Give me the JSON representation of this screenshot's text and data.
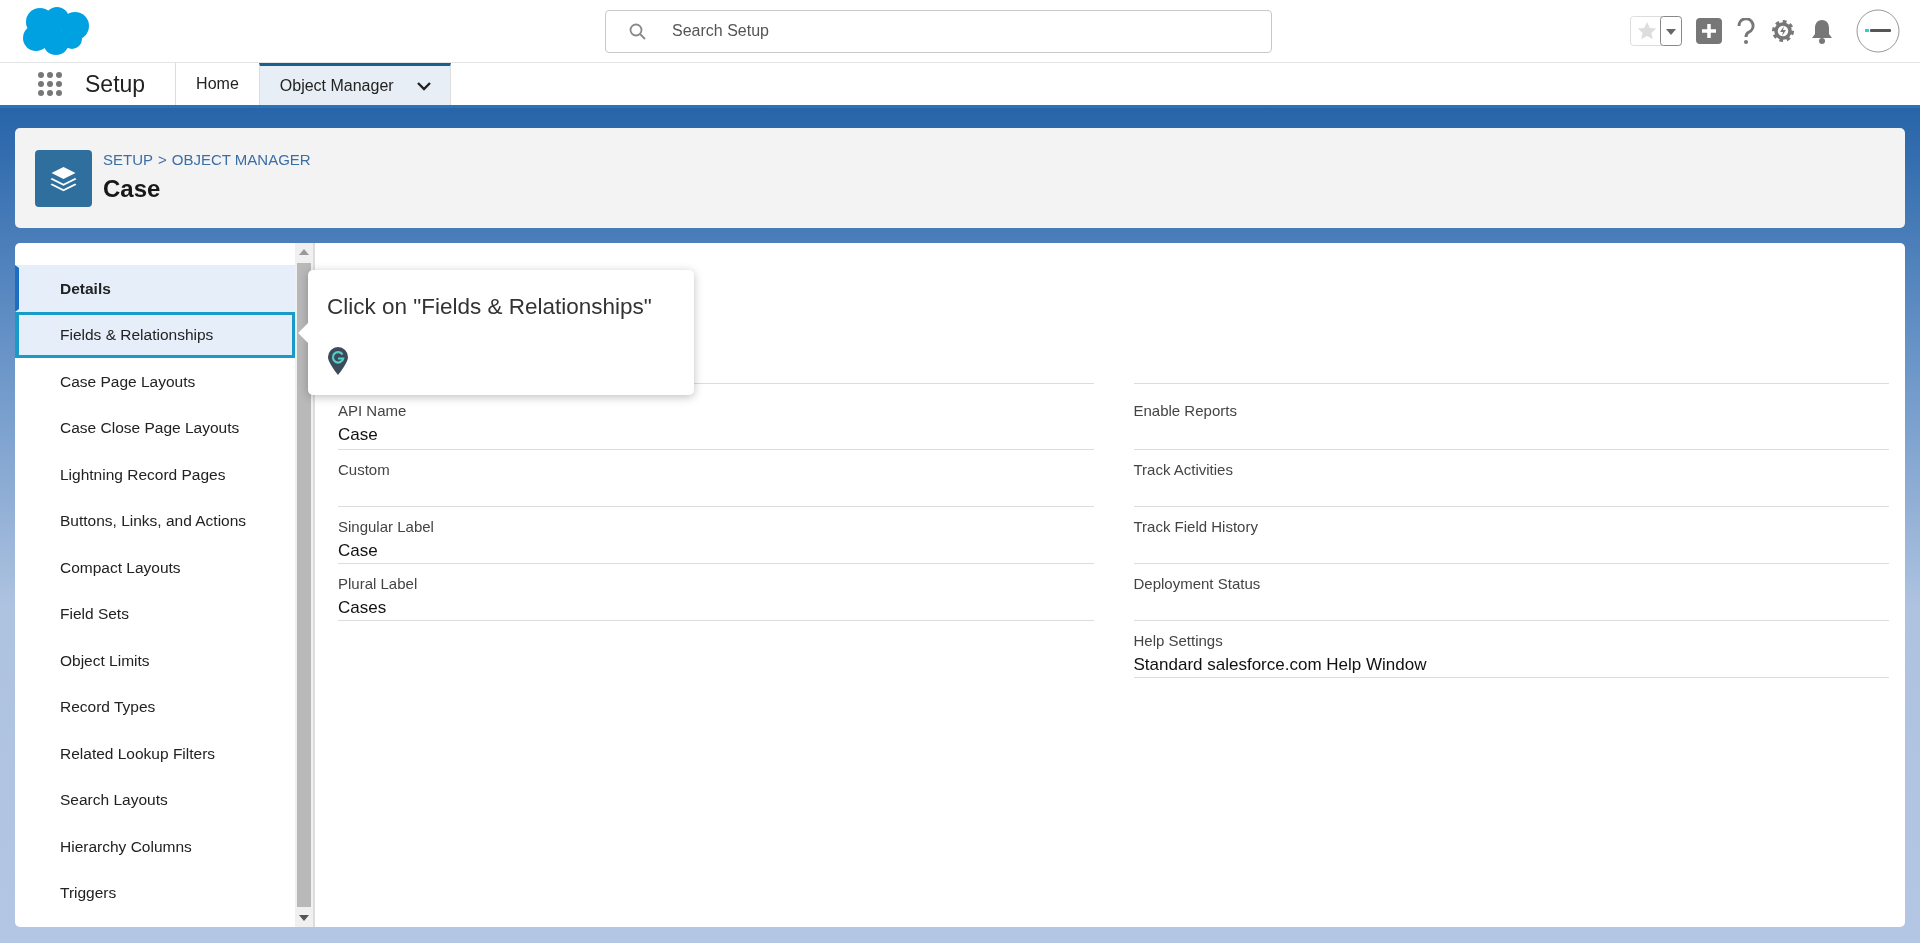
{
  "app": {
    "name": "Setup"
  },
  "search": {
    "placeholder": "Search Setup"
  },
  "nav_tabs": [
    {
      "label": "Home",
      "selected": false,
      "has_menu": false
    },
    {
      "label": "Object Manager",
      "selected": true,
      "has_menu": true
    }
  ],
  "header": {
    "breadcrumb": [
      "SETUP",
      "OBJECT MANAGER"
    ],
    "separator": ">",
    "title": "Case"
  },
  "sidebar": {
    "items": [
      {
        "label": "Details",
        "selected": true,
        "highlighted": false
      },
      {
        "label": "Fields & Relationships",
        "selected": false,
        "highlighted": true
      },
      {
        "label": "Case Page Layouts",
        "selected": false,
        "highlighted": false
      },
      {
        "label": "Case Close Page Layouts",
        "selected": false,
        "highlighted": false
      },
      {
        "label": "Lightning Record Pages",
        "selected": false,
        "highlighted": false
      },
      {
        "label": "Buttons, Links, and Actions",
        "selected": false,
        "highlighted": false
      },
      {
        "label": "Compact Layouts",
        "selected": false,
        "highlighted": false
      },
      {
        "label": "Field Sets",
        "selected": false,
        "highlighted": false
      },
      {
        "label": "Object Limits",
        "selected": false,
        "highlighted": false
      },
      {
        "label": "Record Types",
        "selected": false,
        "highlighted": false
      },
      {
        "label": "Related Lookup Filters",
        "selected": false,
        "highlighted": false
      },
      {
        "label": "Search Layouts",
        "selected": false,
        "highlighted": false
      },
      {
        "label": "Hierarchy Columns",
        "selected": false,
        "highlighted": false
      },
      {
        "label": "Triggers",
        "selected": false,
        "highlighted": false
      }
    ]
  },
  "details": {
    "left": [
      {
        "label": "API Name",
        "value": "Case"
      },
      {
        "label": "Custom"
      },
      {
        "label": "Singular Label",
        "value": "Case"
      },
      {
        "label": "Plural Label",
        "value": "Cases"
      }
    ],
    "right": [
      {
        "label": "Enable Reports"
      },
      {
        "label": "Track Activities"
      },
      {
        "label": "Track Field History"
      },
      {
        "label": "Deployment Status"
      },
      {
        "label": "Help Settings",
        "value": "Standard salesforce.com Help Window"
      }
    ]
  },
  "tooltip": {
    "text": "Click on \"Fields & Relationships\""
  }
}
